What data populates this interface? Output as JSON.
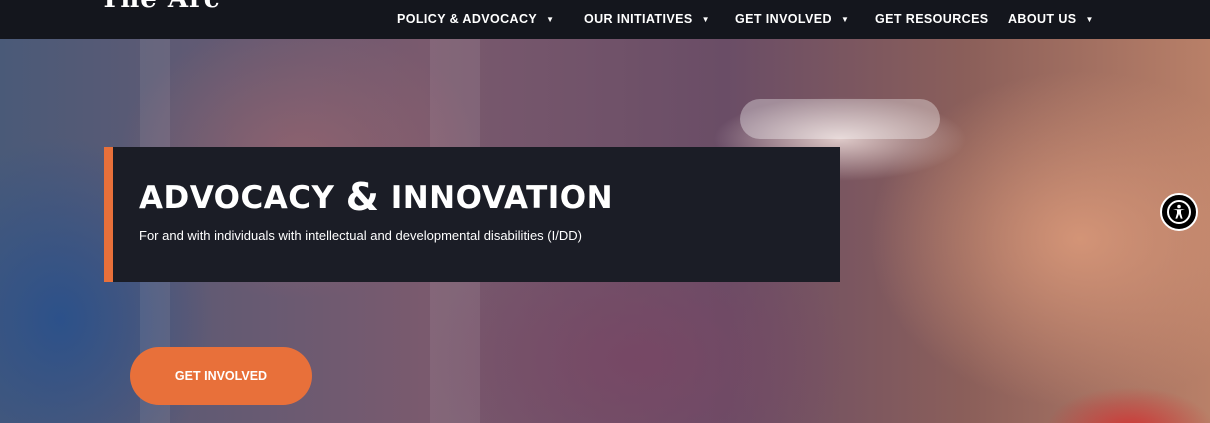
{
  "header": {
    "logo_text": "The Arc",
    "nav": [
      {
        "label": "POLICY & ADVOCACY",
        "has_dropdown": true
      },
      {
        "label": "OUR INITIATIVES",
        "has_dropdown": true
      },
      {
        "label": "GET INVOLVED",
        "has_dropdown": true
      },
      {
        "label": "GET RESOURCES",
        "has_dropdown": false
      },
      {
        "label": "ABOUT US",
        "has_dropdown": true
      }
    ],
    "caret": "▼"
  },
  "hero": {
    "title_part1": "ADVOCACY ",
    "title_amp": "&",
    "title_part2": " INNOVATION",
    "subtitle": "For and with individuals with intellectual and developmental disabilities (I/DD)",
    "cta_label": "GET INVOLVED"
  },
  "accessibility": {
    "icon": "accessibility-icon"
  },
  "colors": {
    "nav_bg": "#14161d",
    "accent": "#e8703a",
    "title_box_bg": "#1b1d26",
    "text": "#ffffff"
  }
}
